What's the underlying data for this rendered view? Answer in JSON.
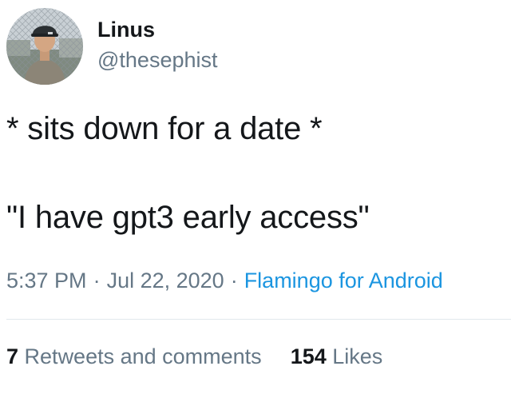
{
  "author": {
    "name": "Linus",
    "handle": "@thesephist"
  },
  "tweet": {
    "lines": [
      "* sits down for a date *",
      "\"I have gpt3 early access\""
    ]
  },
  "meta": {
    "time": "5:37 PM",
    "separator": "·",
    "date": "Jul 22, 2020",
    "source": "Flamingo for Android"
  },
  "stats": {
    "retweets_count": "7",
    "retweets_label": "Retweets and comments",
    "likes_count": "154",
    "likes_label": "Likes"
  },
  "colors": {
    "text": "#14171a",
    "secondary": "#657786",
    "link": "#1b95e0",
    "divider": "#e1e8ed"
  }
}
